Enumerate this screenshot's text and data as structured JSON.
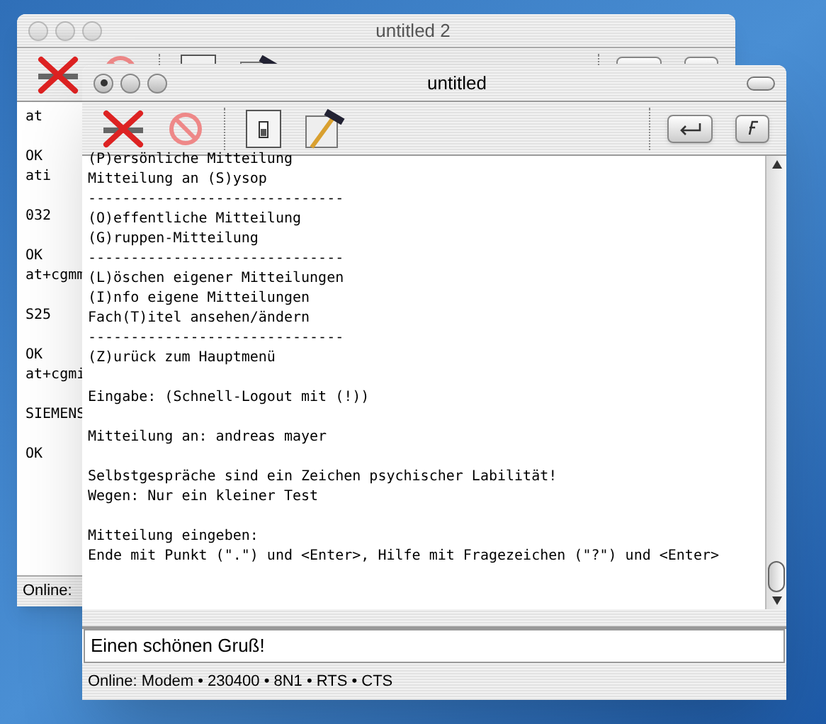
{
  "back_window": {
    "title": "untitled 2",
    "terminal_blocks": [
      [
        "at"
      ],
      [
        "OK",
        "ati"
      ],
      [
        "032"
      ],
      [
        "OK",
        "at+cgmm"
      ],
      [
        "S25"
      ],
      [
        "OK",
        "at+cgmi"
      ],
      [
        "SIEMENS"
      ],
      [
        "OK"
      ]
    ],
    "status_bar": "Online:"
  },
  "front_window": {
    "title": "untitled",
    "active": true,
    "terminal_blocks": [
      [
        "(P)ersönliche Mitteilung",
        "Mitteilung an (S)ysop",
        "------------------------------",
        "(O)effentliche Mitteilung",
        "(G)ruppen-Mitteilung",
        "------------------------------",
        "(L)öschen eigener Mitteilungen",
        "(I)nfo eigene Mitteilungen",
        "Fach(T)itel ansehen/ändern",
        "------------------------------",
        "(Z)urück zum Hauptmenü"
      ],
      [
        "Eingabe: (Schnell-Logout mit (!))"
      ],
      [
        "Mitteilung an: andreas mayer"
      ],
      [
        "Selbstgespräche sind ein Zeichen psychischer Labilität!",
        "Wegen: Nur ein kleiner Test"
      ],
      [
        "Mitteilung eingeben:",
        "Ende mit Punkt (\".\") und <Enter>, Hilfe mit Fragezeichen (\"?\") und <Enter>"
      ]
    ],
    "input": {
      "value": "Einen schönen Gruß!"
    },
    "status_bar": "Online: Modem • 230400 • 8N1 • RTS • CTS"
  }
}
